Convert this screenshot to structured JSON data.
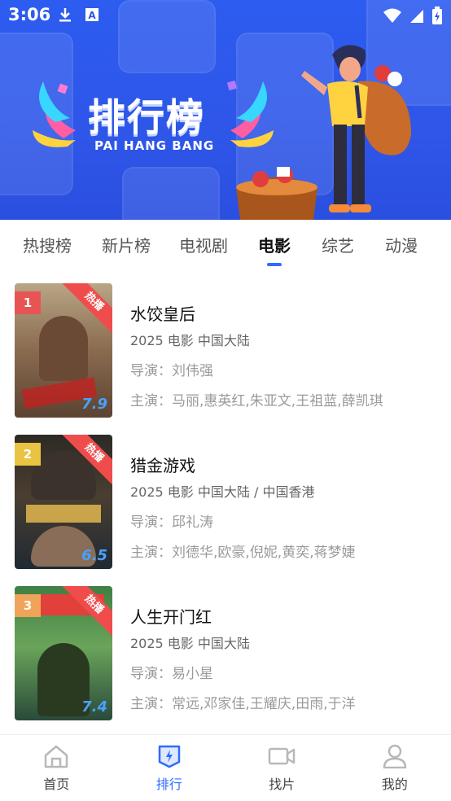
{
  "status_bar": {
    "time": "3:06",
    "left_icons": [
      "download-icon",
      "font-a-icon"
    ],
    "right_icons": [
      "wifi-icon",
      "signal-icon",
      "battery-charging-icon"
    ]
  },
  "banner": {
    "title": "排行榜",
    "subtitle": "PAI HANG BANG",
    "background_color": "#2e56e8"
  },
  "tabs": [
    {
      "label": "热搜榜",
      "active": false
    },
    {
      "label": "新片榜",
      "active": false
    },
    {
      "label": "电视剧",
      "active": false
    },
    {
      "label": "电影",
      "active": true
    },
    {
      "label": "综艺",
      "active": false
    },
    {
      "label": "动漫",
      "active": false
    }
  ],
  "accent_color": "#2f6bff",
  "movies": [
    {
      "rank": "1",
      "rank_color": "#e85454",
      "badge": "热播",
      "score": "7.9",
      "title": "水饺皇后",
      "meta": "2025  电影  中国大陆",
      "director": "导演：刘伟强",
      "cast": "主演：马丽,惠英红,朱亚文,王祖蓝,薛凯琪"
    },
    {
      "rank": "2",
      "rank_color": "#e9c341",
      "badge": "热播",
      "score": "6.5",
      "title": "猎金游戏",
      "meta": "2025  电影  中国大陆 / 中国香港",
      "director": "导演：邱礼涛",
      "cast": "主演：刘德华,欧豪,倪妮,黄奕,蒋梦婕"
    },
    {
      "rank": "3",
      "rank_color": "#f0a45a",
      "badge": "热播",
      "score": "7.4",
      "title": "人生开门红",
      "meta": "2025  电影  中国大陆",
      "director": "导演：易小星",
      "cast": "主演：常远,邓家佳,王耀庆,田雨,于洋"
    }
  ],
  "bottom_nav": [
    {
      "label": "首页",
      "icon": "home-icon",
      "active": false
    },
    {
      "label": "排行",
      "icon": "ranking-icon",
      "active": true
    },
    {
      "label": "找片",
      "icon": "video-camera-icon",
      "active": false
    },
    {
      "label": "我的",
      "icon": "user-icon",
      "active": false
    }
  ]
}
